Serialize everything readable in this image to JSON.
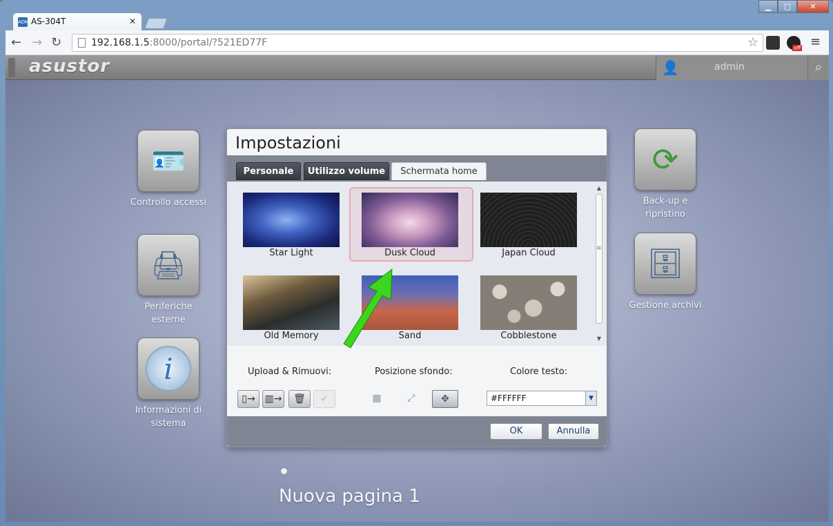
{
  "browser": {
    "tab_title": "AS-304T",
    "tab_favicon_text": "ADM",
    "url_host": "192.168.1.5",
    "url_rest": ":8000/portal/?521ED77F",
    "ext_badge": "off"
  },
  "header": {
    "logo": "asustor",
    "user": "admin"
  },
  "desktop": {
    "apps_left": [
      {
        "label": "Controllo accessi"
      },
      {
        "label": "Periferiche esterne"
      },
      {
        "label": "Informazioni di sistema"
      }
    ],
    "apps_right": [
      {
        "label": "Back-up e ripristino"
      },
      {
        "label": "Gestione archivi"
      }
    ],
    "page_name": "Nuova pagina 1"
  },
  "dialog": {
    "title": "Impostazioni",
    "tabs": [
      {
        "label": "Personale"
      },
      {
        "label": "Utilizzo volume"
      },
      {
        "label": "Schermata home"
      }
    ],
    "active_tab": "Schermata home",
    "wallpapers": [
      {
        "label": "Star Light"
      },
      {
        "label": "Dusk Cloud"
      },
      {
        "label": "Japan Cloud"
      },
      {
        "label": "Old Memory"
      },
      {
        "label": "Sand"
      },
      {
        "label": "Cobblestone"
      }
    ],
    "selected_wallpaper": "Dusk Cloud",
    "upload_label": "Upload & Rimuovi:",
    "position_label": "Posizione sfondo:",
    "textcolor_label": "Colore testo:",
    "text_color_value": "#FFFFFF",
    "ok_label": "OK",
    "cancel_label": "Annulla"
  },
  "colors": {
    "annotation_arrow": "#3bd61e",
    "selection": "#e7a9b4"
  }
}
